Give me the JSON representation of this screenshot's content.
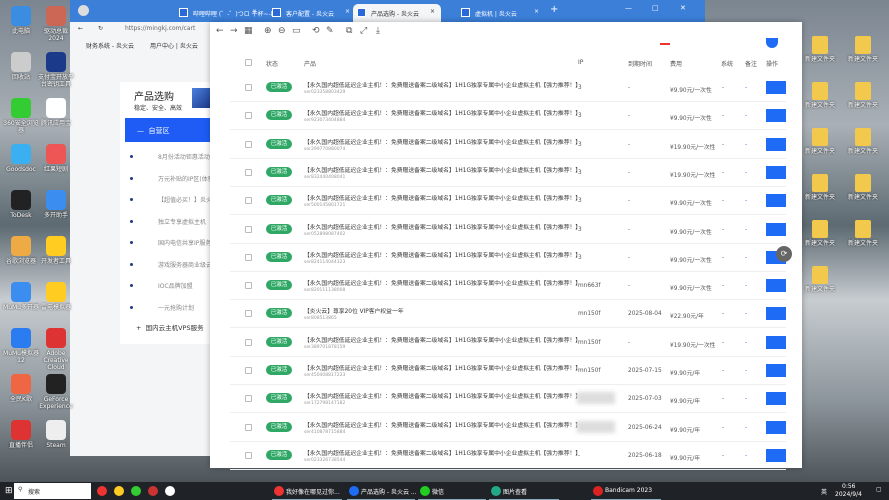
{
  "desktop_left": [
    "此电脑",
    "驱动总裁2024",
    "回收站",
    "支付宝开放平台密钥工具",
    "360安全浏览器",
    "腾讯应用宝",
    "Goodsdoc",
    "红果短剧",
    "ToDesk",
    "多开助手",
    "谷歌浏览器",
    "开发者工具",
    "MuMu多开器",
    "雷电模拟器",
    "MuMu模拟器12",
    "Adobe Creative Cloud",
    "全民K歌",
    "GeForce Experience",
    "直播伴侣",
    "Steam"
  ],
  "desktop_right": [
    "新建文件夹",
    "新建文件夹",
    "新建文件夹",
    "新建文件夹",
    "新建文件夹",
    "新建文件夹",
    "新建文件夹",
    "新建文件夹",
    "新建文件夹",
    "新建文件夹",
    "新建文件夹"
  ],
  "browser": {
    "tabs": [
      {
        "label": "哔哩哔哩 (゜-゜)つロ 干杯~-bili"
      },
      {
        "label": "客户配置 - 炎火云"
      },
      {
        "label": "产品选购 - 炎火云",
        "active": true
      },
      {
        "label": "虚拟机 | 炎火云"
      }
    ],
    "url": "https://mingkj.com/cart",
    "bookmarks": [
      "财务系统 - 炎火云",
      "用户中心 | 炎火云"
    ],
    "panel": {
      "title": "产品选购",
      "subtitle": "稳定、安全、高效",
      "section": "自营区",
      "items": [
        "8月份活动钜惠活动",
        "万元补贴的IP区(体验)",
        "【超值必买！】炎火",
        "独立专享虚拟主机",
        "国内电信共享IP服务器",
        "游戏服务器商业级云",
        "IOC品牌加盟",
        "一元抢购计划"
      ],
      "more": "国内云主机VPS服务"
    }
  },
  "table": {
    "headers": [
      "状态",
      "产品",
      "IP",
      "到期时间",
      "费用",
      "系统",
      "备注",
      "操作"
    ],
    "rows": [
      {
        "status": "已激活",
        "name": "【永久国内超低延迟企业主机！：免费赠送备案二级域名】1H1G独享专属中小企业虚拟主机【强力推荐！】",
        "id": "ser023358803429",
        "ip": "3",
        "expire": "-",
        "price": "¥9.90元/一次性",
        "os": "-",
        "note": "-"
      },
      {
        "status": "已激活",
        "name": "【永久国内超低延迟企业主机！：免费赠送备案二级域名】1H1G独享专属中小企业虚拟主机【强力推荐！】",
        "id": "ser923073404884",
        "ip": "3",
        "expire": "-",
        "price": "¥9.90元/一次性",
        "os": "-",
        "note": "-"
      },
      {
        "status": "已激活",
        "name": "【永久国内超低延迟企业主机！：免费赠送备案二级域名】1H1G独享专属中小企业虚拟主机【强力推荐！】",
        "id": "ser299770880074",
        "ip": "3",
        "expire": "-",
        "price": "¥19.90元/一次性",
        "os": "-",
        "note": "-"
      },
      {
        "status": "已激活",
        "name": "【永久国内超低延迟企业主机！：免费赠送备案二级域名】1H1G独享专属中小企业虚拟主机【强力推荐！】",
        "id": "ser832440408041",
        "ip": "3",
        "expire": "-",
        "price": "¥19.90元/一次性",
        "os": "-",
        "note": "-"
      },
      {
        "status": "已激活",
        "name": "【永久国内超低延迟企业主机！：免费赠送备案二级域名】1H1G独享专属中小企业虚拟主机【强力推荐！】",
        "id": "ser500145801721",
        "ip": "3",
        "expire": "-",
        "price": "¥9.90元/一次性",
        "os": "-",
        "note": "-"
      },
      {
        "status": "已激活",
        "name": "【永久国内超低延迟企业主机！：免费赠送备案二级域名】1H1G独享专属中小企业虚拟主机【强力推荐！】",
        "id": "ser052898087402",
        "ip": "3",
        "expire": "-",
        "price": "¥9.90元/一次性",
        "os": "-",
        "note": "-"
      },
      {
        "status": "已激活",
        "name": "【永久国内超低延迟企业主机！：免费赠送备案二级域名】1H1G独享专属中小企业虚拟主机【强力推荐！】",
        "id": "ser824114044323",
        "ip": "3",
        "expire": "-",
        "price": "¥9.90元/一次性",
        "os": "-",
        "note": "-"
      },
      {
        "status": "已激活",
        "name": "【永久国内超低延迟企业主机！：免费赠送备案二级域名】1H1G独享专属中小企业虚拟主机【强力推荐！】",
        "id": "ser820111138008",
        "ip": "mn663f",
        "expire": "-",
        "price": "¥9.90元/一次性",
        "os": "-",
        "note": "-"
      },
      {
        "status": "已激活",
        "name": "【炎火云】尊享20位 VIP客户权益一年",
        "id": "ser808513865",
        "ip": "mn150f",
        "expire": "2025-08-04",
        "price": "¥22.90元/年",
        "os": "-",
        "note": "-"
      },
      {
        "status": "已激活",
        "name": "【永久国内超低延迟企业主机！：免费赠送备案二级域名】1H1G独享专属中小企业虚拟主机【强力推荐！】",
        "id": "ser389701878159",
        "ip": "mn150f",
        "expire": "-",
        "price": "¥19.90元/一次性",
        "os": "-",
        "note": "-"
      },
      {
        "status": "已激活",
        "name": "【永久国内超低延迟企业主机！：免费赠送备案二级域名】1H1G独享专属中小企业虚拟主机【强力推荐！】",
        "id": "ser450408817223",
        "ip": "mn150f",
        "expire": "2025-07-15",
        "price": "¥9.90元/年",
        "os": "-",
        "note": "-"
      },
      {
        "status": "已激活",
        "name": "【永久国内超低延迟企业主机！：免费赠送备案二级域名】1H1G独享专属中小企业虚拟主机【强力推荐！】",
        "id": "ser172798147182",
        "ip": "",
        "blurred": true,
        "expire": "2025-07-03",
        "price": "¥9.90元/年",
        "os": "-",
        "note": "-"
      },
      {
        "status": "已激活",
        "name": "【永久国内超低延迟企业主机！：免费赠送备案二级域名】1H1G独享专属中小企业虚拟主机【强力推荐！】",
        "id": "ser410878715884",
        "ip": "",
        "blurred": true,
        "expire": "2025-06-24",
        "price": "¥9.90元/年",
        "os": "-",
        "note": "-"
      },
      {
        "status": "已激活",
        "name": "【永久国内超低延迟企业主机！：免费赠送备案二级域名】1H1G独享专属中小企业虚拟主机【强力推荐！】",
        "id": "ser023326738544",
        "ip": "-",
        "expire": "2025-06-18",
        "price": "¥9.90元/年",
        "os": "-",
        "note": "-"
      }
    ]
  },
  "taskbar": {
    "search": "搜索",
    "apps": [
      "我好像在哪见过你...",
      "产品选购 - 炎火云 ...",
      "微信",
      "图片查看",
      "Bandicam 2023"
    ],
    "ime": "英",
    "time": "0:56",
    "date": "2024/9/4"
  },
  "colors": {
    "accent": "#1e6cf5",
    "active_badge": "#2fa866",
    "tabbar": "#3b7fd9"
  }
}
